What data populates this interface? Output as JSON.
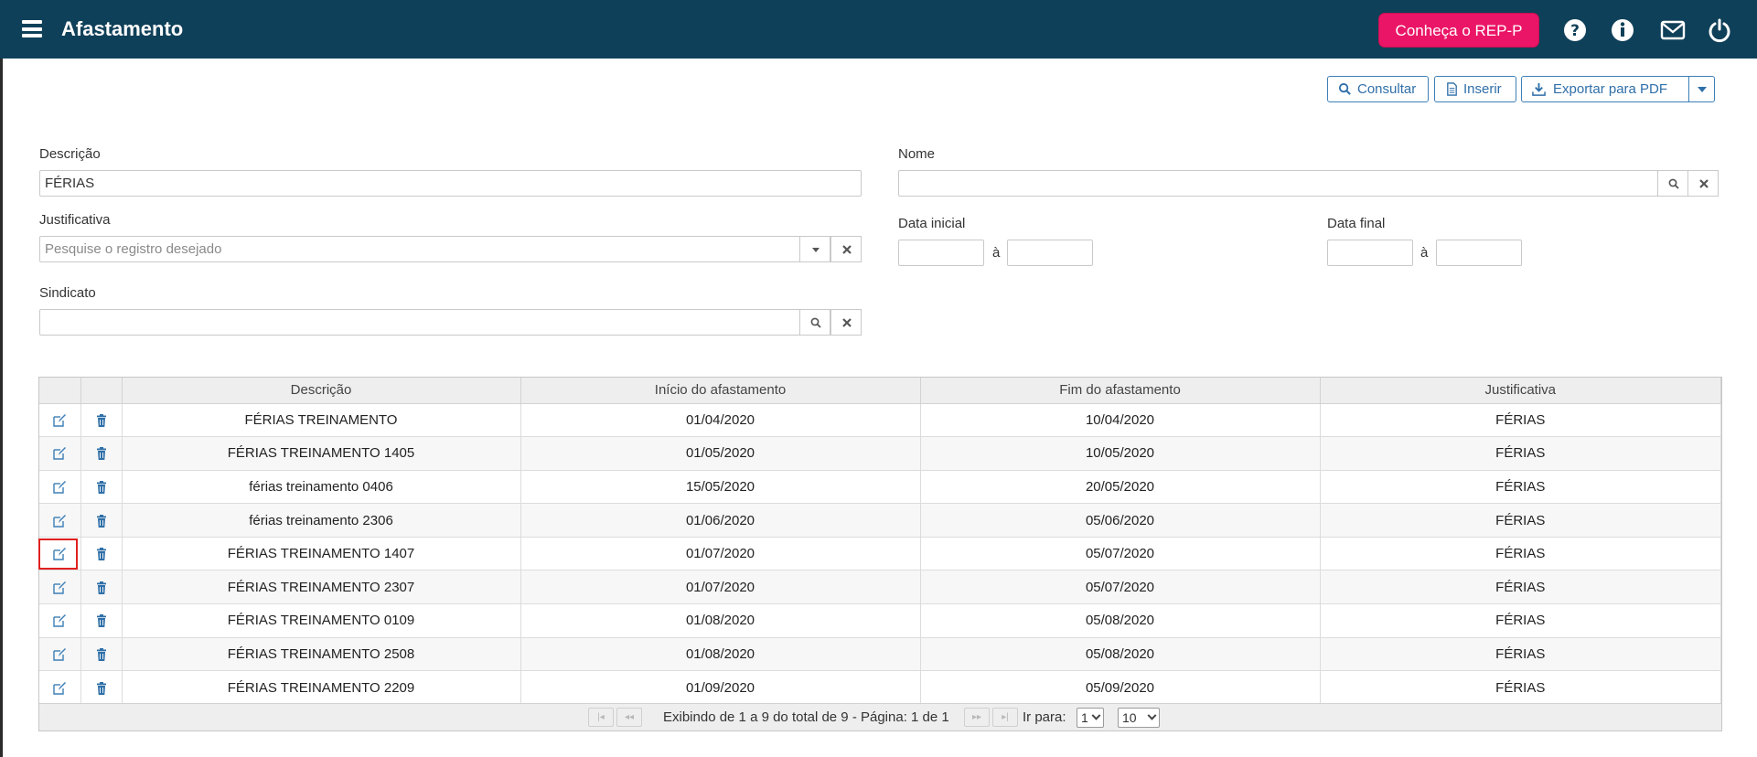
{
  "header": {
    "title": "Afastamento",
    "cta_label": "Conheça o REP-P",
    "icons": [
      "menu-icon",
      "help-icon",
      "info-icon",
      "mail-icon",
      "power-icon"
    ]
  },
  "toolbar": {
    "consultar_label": "Consultar",
    "inserir_label": "Inserir",
    "exportar_label": "Exportar para PDF"
  },
  "form": {
    "descricao_label": "Descrição",
    "descricao_value": "FÉRIAS",
    "nome_label": "Nome",
    "nome_value": "",
    "justificativa_label": "Justificativa",
    "justificativa_placeholder": "Pesquise o registro desejado",
    "data_inicial_label": "Data inicial",
    "data_final_label": "Data final",
    "range_separator": "à",
    "sindicato_label": "Sindicato",
    "sindicato_value": ""
  },
  "table": {
    "columns": [
      "Descrição",
      "Início do afastamento",
      "Fim do afastamento",
      "Justificativa"
    ],
    "rows": [
      {
        "descricao": "FÉRIAS TREINAMENTO",
        "inicio": "01/04/2020",
        "fim": "10/04/2020",
        "justificativa": "FÉRIAS"
      },
      {
        "descricao": "FÉRIAS TREINAMENTO 1405",
        "inicio": "01/05/2020",
        "fim": "10/05/2020",
        "justificativa": "FÉRIAS"
      },
      {
        "descricao": "férias treinamento 0406",
        "inicio": "15/05/2020",
        "fim": "20/05/2020",
        "justificativa": "FÉRIAS"
      },
      {
        "descricao": "férias treinamento 2306",
        "inicio": "01/06/2020",
        "fim": "05/06/2020",
        "justificativa": "FÉRIAS"
      },
      {
        "descricao": "FÉRIAS TREINAMENTO 1407",
        "inicio": "01/07/2020",
        "fim": "05/07/2020",
        "justificativa": "FÉRIAS"
      },
      {
        "descricao": "FÉRIAS TREINAMENTO 2307",
        "inicio": "01/07/2020",
        "fim": "05/07/2020",
        "justificativa": "FÉRIAS"
      },
      {
        "descricao": "FÉRIAS TREINAMENTO 0109",
        "inicio": "01/08/2020",
        "fim": "05/08/2020",
        "justificativa": "FÉRIAS"
      },
      {
        "descricao": "FÉRIAS TREINAMENTO 2508",
        "inicio": "01/08/2020",
        "fim": "05/08/2020",
        "justificativa": "FÉRIAS"
      },
      {
        "descricao": "FÉRIAS TREINAMENTO 2209",
        "inicio": "01/09/2020",
        "fim": "05/09/2020",
        "justificativa": "FÉRIAS"
      }
    ],
    "highlighted_row_index": 4
  },
  "pager": {
    "summary": "Exibindo de 1 a 9 do total de 9 - Página: 1 de 1",
    "goto_label": "Ir para:",
    "page_value": "1",
    "page_size_value": "10"
  },
  "colors": {
    "header_bg": "#0f4059",
    "cta_bg": "#ea1566",
    "accent_blue": "#2f6fa8",
    "highlight_border": "#e02020"
  }
}
